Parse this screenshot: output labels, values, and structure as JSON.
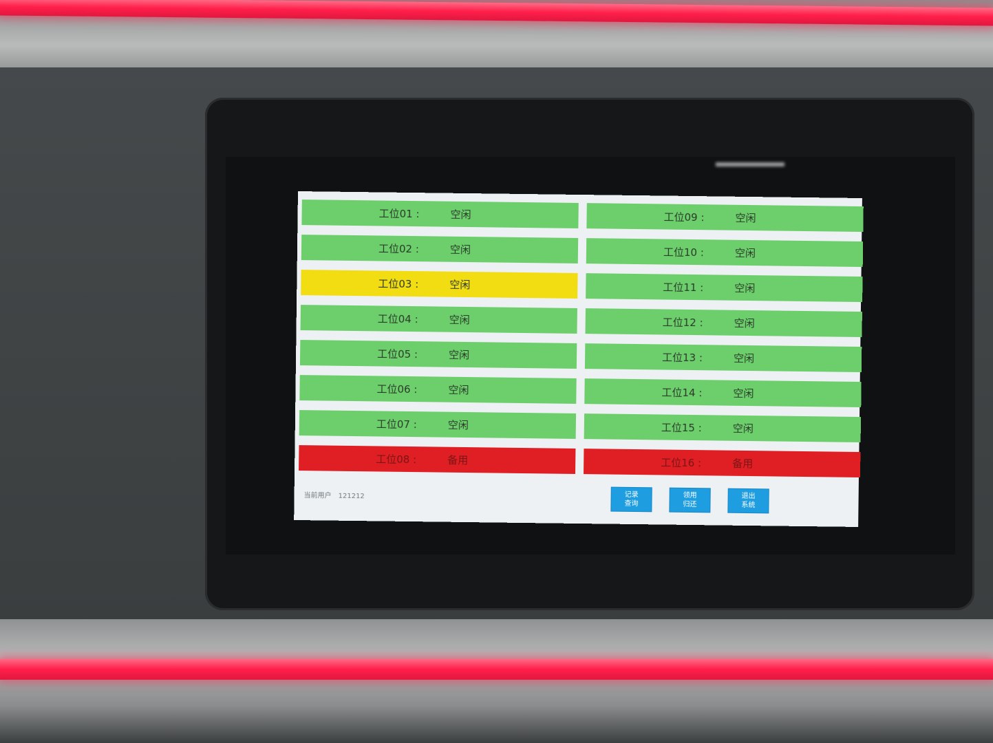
{
  "stations_left": [
    {
      "name": "工位01 :",
      "status": "空闲",
      "color": "#6dcf6c"
    },
    {
      "name": "工位02 :",
      "status": "空闲",
      "color": "#6dcf6c"
    },
    {
      "name": "工位03 :",
      "status": "空闲",
      "color": "#f2dc12"
    },
    {
      "name": "工位04 :",
      "status": "空闲",
      "color": "#6dcf6c"
    },
    {
      "name": "工位05 :",
      "status": "空闲",
      "color": "#6dcf6c"
    },
    {
      "name": "工位06 :",
      "status": "空闲",
      "color": "#6dcf6c"
    },
    {
      "name": "工位07 :",
      "status": "空闲",
      "color": "#6dcf6c"
    },
    {
      "name": "工位08 :",
      "status": "备用",
      "color": "#df1f24"
    }
  ],
  "stations_right": [
    {
      "name": "工位09 :",
      "status": "空闲",
      "color": "#6dcf6c"
    },
    {
      "name": "工位10 :",
      "status": "空闲",
      "color": "#6dcf6c"
    },
    {
      "name": "工位11 :",
      "status": "空闲",
      "color": "#6dcf6c"
    },
    {
      "name": "工位12 :",
      "status": "空闲",
      "color": "#6dcf6c"
    },
    {
      "name": "工位13 :",
      "status": "空闲",
      "color": "#6dcf6c"
    },
    {
      "name": "工位14 :",
      "status": "空闲",
      "color": "#6dcf6c"
    },
    {
      "name": "工位15 :",
      "status": "空闲",
      "color": "#6dcf6c"
    },
    {
      "name": "工位16 :",
      "status": "备用",
      "color": "#df1f24"
    }
  ],
  "footer": {
    "user_label": "当前用户",
    "user_value": "121212"
  },
  "buttons": {
    "records": {
      "line1": "记录",
      "line2": "查询"
    },
    "return": {
      "line1": "领用",
      "line2": "归还"
    },
    "exit": {
      "line1": "退出",
      "line2": "系统"
    }
  },
  "colors": {
    "button": "#1e9de0",
    "idle": "#6dcf6c",
    "warning": "#f2dc12",
    "standby": "#df1f24"
  }
}
